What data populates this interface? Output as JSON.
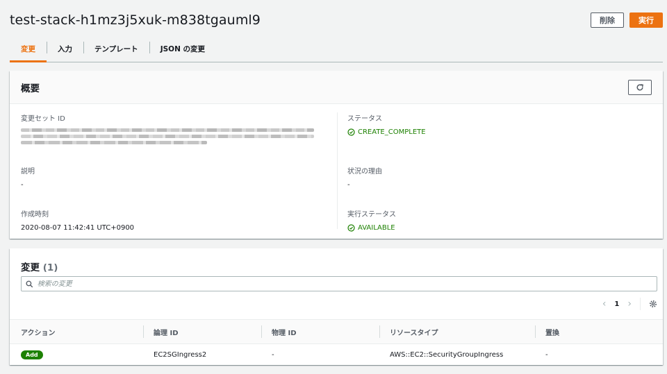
{
  "header": {
    "title": "test-stack-h1mz3j5xuk-m838tgauml9",
    "delete_label": "削除",
    "execute_label": "実行"
  },
  "tabs": [
    {
      "label": "変更",
      "active": true
    },
    {
      "label": "入力",
      "active": false
    },
    {
      "label": "テンプレート",
      "active": false
    },
    {
      "label": "JSON の変更",
      "active": false
    }
  ],
  "overview": {
    "title": "概要",
    "refresh_icon": "refresh-icon",
    "change_set_id_label": "変更セット ID",
    "status_label": "ステータス",
    "status_value": "CREATE_COMPLETE",
    "description_label": "説明",
    "description_value": "-",
    "status_reason_label": "状況の理由",
    "status_reason_value": "-",
    "created_label": "作成時刻",
    "created_value": "2020-08-07 11:42:41 UTC+0900",
    "exec_status_label": "実行ステータス",
    "exec_status_value": "AVAILABLE"
  },
  "changes": {
    "title": "変更",
    "count": "(1)",
    "search_placeholder": "検索の変更",
    "page": "1",
    "columns": [
      "アクション",
      "論理 ID",
      "物理 ID",
      "リソースタイプ",
      "置換"
    ],
    "rows": [
      {
        "action": "Add",
        "logical_id": "EC2SGIngress2",
        "physical_id": "-",
        "resource_type": "AWS::EC2::SecurityGroupIngress",
        "replacement": "-"
      }
    ]
  },
  "colors": {
    "accent": "#ec7211",
    "success": "#1d8102"
  }
}
